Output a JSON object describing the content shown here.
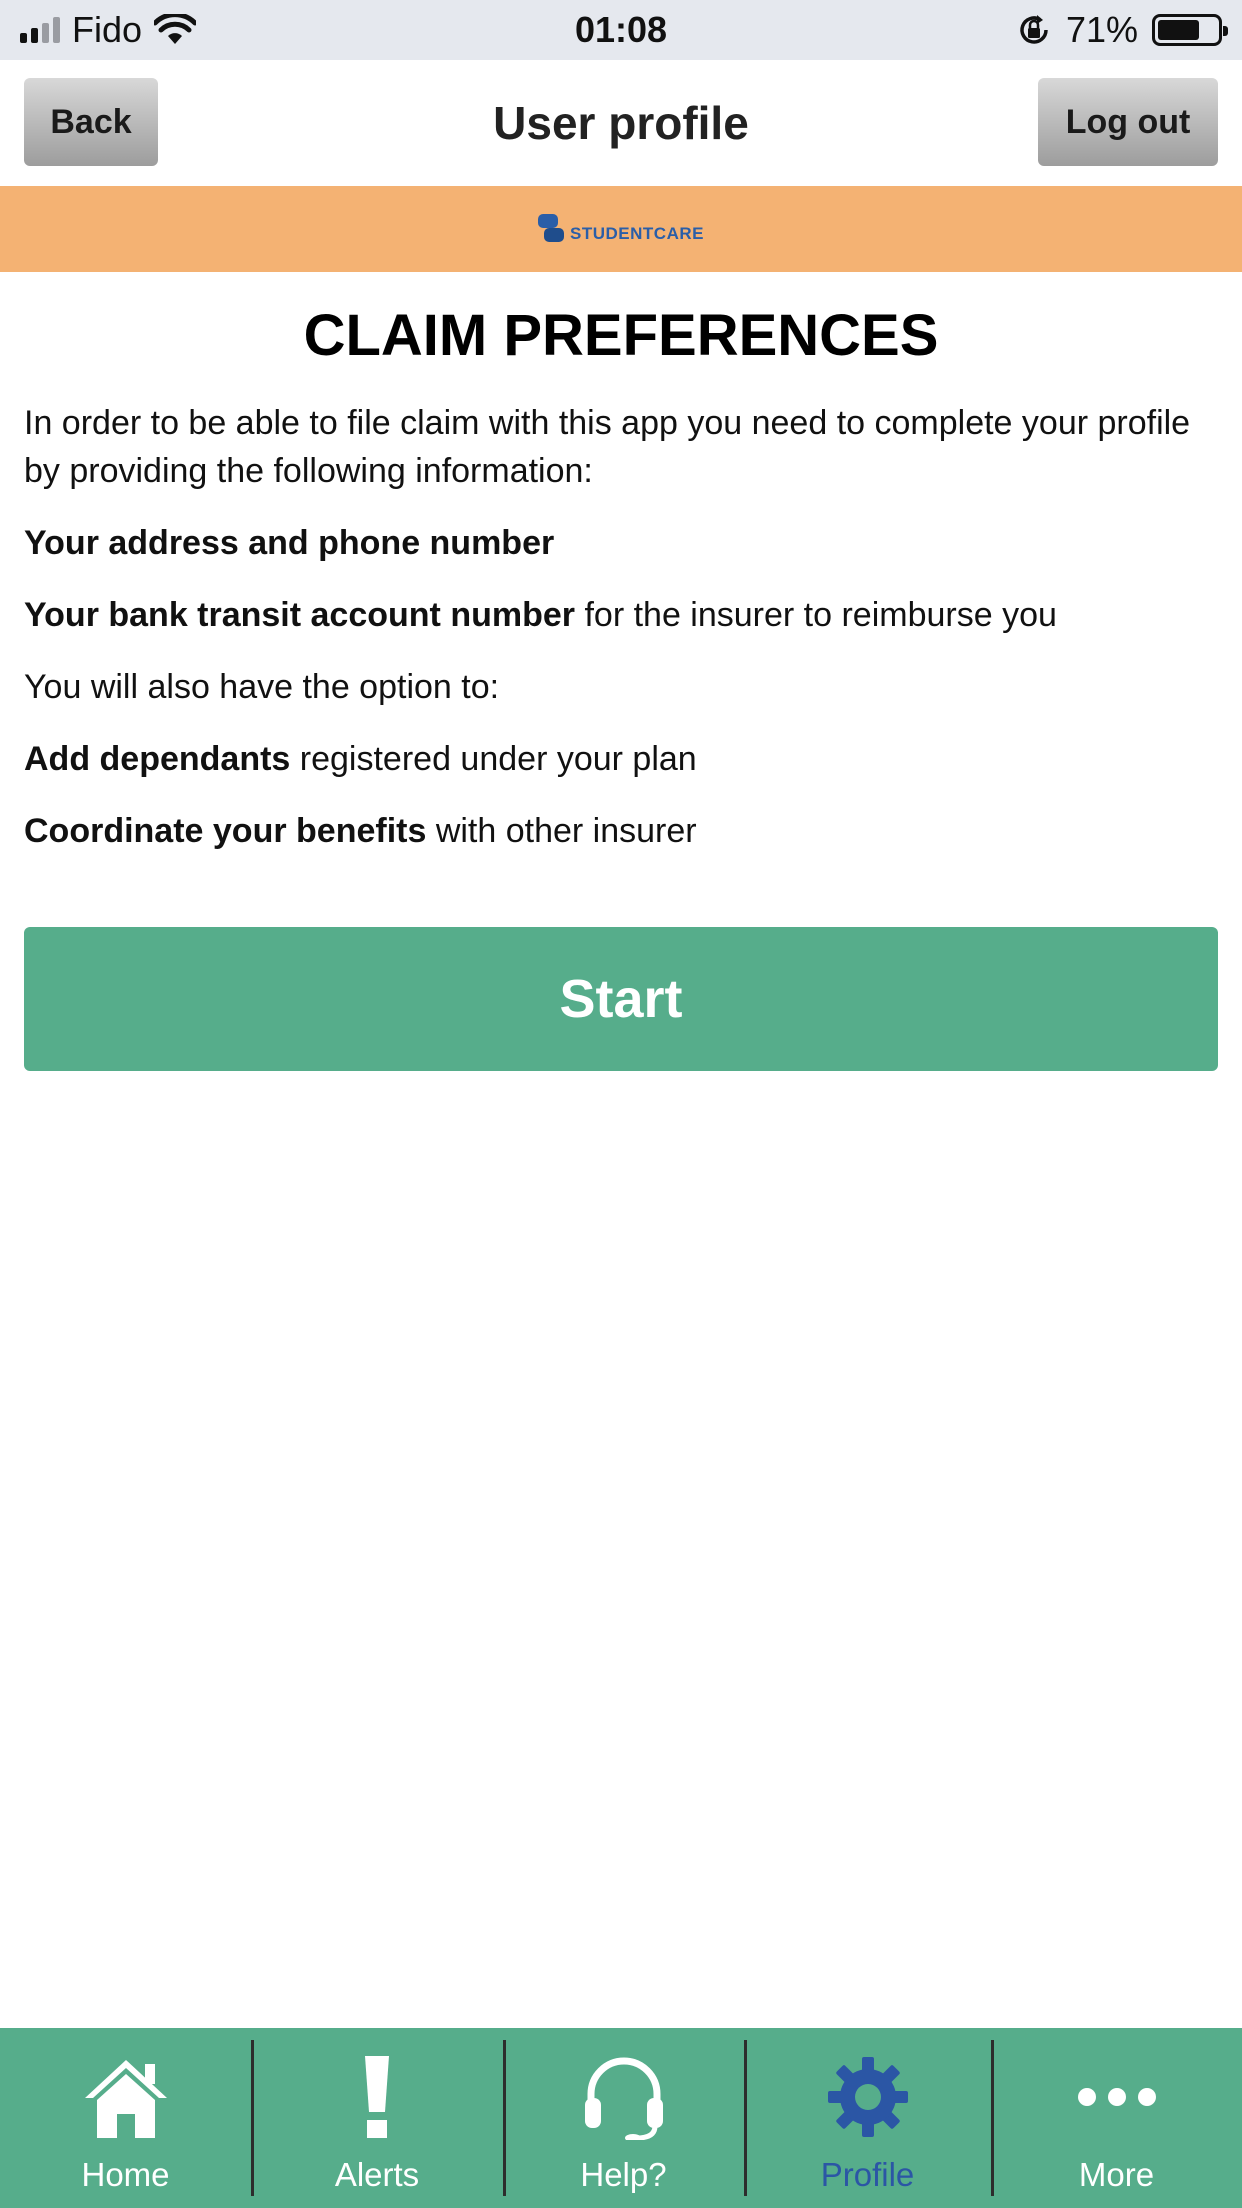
{
  "status_bar": {
    "carrier": "Fido",
    "time": "01:08",
    "battery_text": "71%",
    "battery_level": 0.71
  },
  "nav": {
    "back_label": "Back",
    "title": "User profile",
    "logout_label": "Log out"
  },
  "brand": {
    "logo_text": "STUDENTCARE",
    "band_color": "#f4b273"
  },
  "main": {
    "heading": "CLAIM PREFERENCES",
    "intro": "In order to be able to file claim with this app you need to complete your profile by providing the following information:",
    "item1_bold": "Your address and phone number",
    "item2_bold": "Your bank transit account number",
    "item2_rest": " for the insurer to reimburse you",
    "option_intro": "You will also have the option to:",
    "item3_bold": "Add dependants",
    "item3_rest": " registered under your plan",
    "item4_bold": "Coordinate your benefits",
    "item4_rest": " with other insurer",
    "start_label": "Start"
  },
  "tabs": [
    {
      "label": "Home",
      "icon": "home-icon",
      "active": false
    },
    {
      "label": "Alerts",
      "icon": "exclamation-icon",
      "active": false
    },
    {
      "label": "Help?",
      "icon": "headset-icon",
      "active": false
    },
    {
      "label": "Profile",
      "icon": "gear-icon",
      "active": true
    },
    {
      "label": "More",
      "icon": "ellipsis-icon",
      "active": false
    }
  ],
  "colors": {
    "accent_green": "#56ad8b",
    "active_tab": "#2b56a5",
    "logo_blue": "#2a5ea8"
  }
}
